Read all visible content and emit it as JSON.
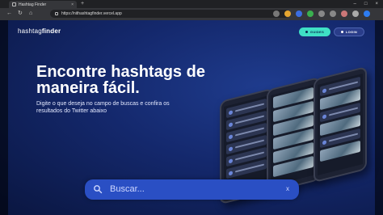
{
  "browser": {
    "tab_title": "Hashtag Finder",
    "url": "https://nithashtagfinder.vercel.app",
    "new_tab_symbol": "+",
    "close_symbol": "×",
    "window_controls": [
      "–",
      "□",
      "×"
    ]
  },
  "header": {
    "logo_normal": "hashtag",
    "logo_bold": "finder",
    "guides_label": "GUIDES",
    "login_label": "LOGIN"
  },
  "hero": {
    "headline": "Encontre hashtags de maneira fácil.",
    "subtitle": "Digite o que deseja no campo de buscas e confira os resultados do Twitter abaixo"
  },
  "search": {
    "placeholder": "Buscar...",
    "clear_symbol": "x"
  },
  "colors": {
    "accent": "#3fe0c5",
    "search_bg": "#2a4fc4",
    "page_bg": "#14286c"
  }
}
